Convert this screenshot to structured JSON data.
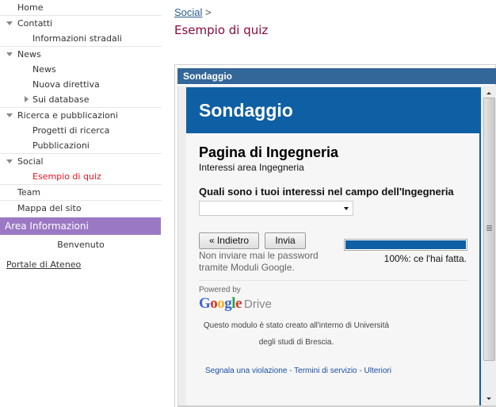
{
  "sidebar": {
    "items": [
      {
        "label": "Home"
      },
      {
        "label": "Contatti"
      },
      {
        "label": "Informazioni stradali"
      },
      {
        "label": "News"
      },
      {
        "label": "News"
      },
      {
        "label": "Nuova direttiva"
      },
      {
        "label": "Sui database"
      },
      {
        "label": "Ricerca e pubblicazioni"
      },
      {
        "label": "Progetti di ricerca"
      },
      {
        "label": "Pubblicazioni"
      },
      {
        "label": "Social"
      },
      {
        "label": "Esempio di quiz"
      },
      {
        "label": "Team"
      },
      {
        "label": "Mappa del sito"
      }
    ],
    "area_title": "Area Informazioni",
    "welcome": "Benvenuto",
    "portal_link": "Portale di Ateneo"
  },
  "breadcrumb": {
    "parent": "Social",
    "separator": ">"
  },
  "page_title": "Esempio di quiz",
  "gadget": {
    "title": "Sondaggio",
    "form": {
      "banner": "Sondaggio",
      "page_title": "Pagina di Ingegneria",
      "page_description": "Interessi area Ingegneria",
      "question": "Quali sono i tuoi interessi nel campo dell'Ingegneria",
      "select_value": "",
      "back_button": "« Indietro",
      "submit_button": "Invia",
      "password_note": "Non inviare mai le password tramite Moduli Google.",
      "progress_percent": 100,
      "progress_text": "100%: ce l'hai fatta.",
      "powered_by": "Powered by",
      "brand_google": "Google",
      "brand_drive": "Drive",
      "created_line1": "Questo modulo è stato creato all'interno di Università",
      "created_line2": "degli studi di Brescia.",
      "footer_links": {
        "report": "Segnala una violazione",
        "terms": "Termini di servizio",
        "more": "Ulteriori",
        "separator": " - "
      }
    }
  },
  "colors": {
    "accent_blue": "#0e5fa3",
    "gadget_header": "#336699",
    "area_purple": "#9b78c3",
    "active_red": "#e8141e",
    "title_maroon": "#8a0a3c"
  }
}
